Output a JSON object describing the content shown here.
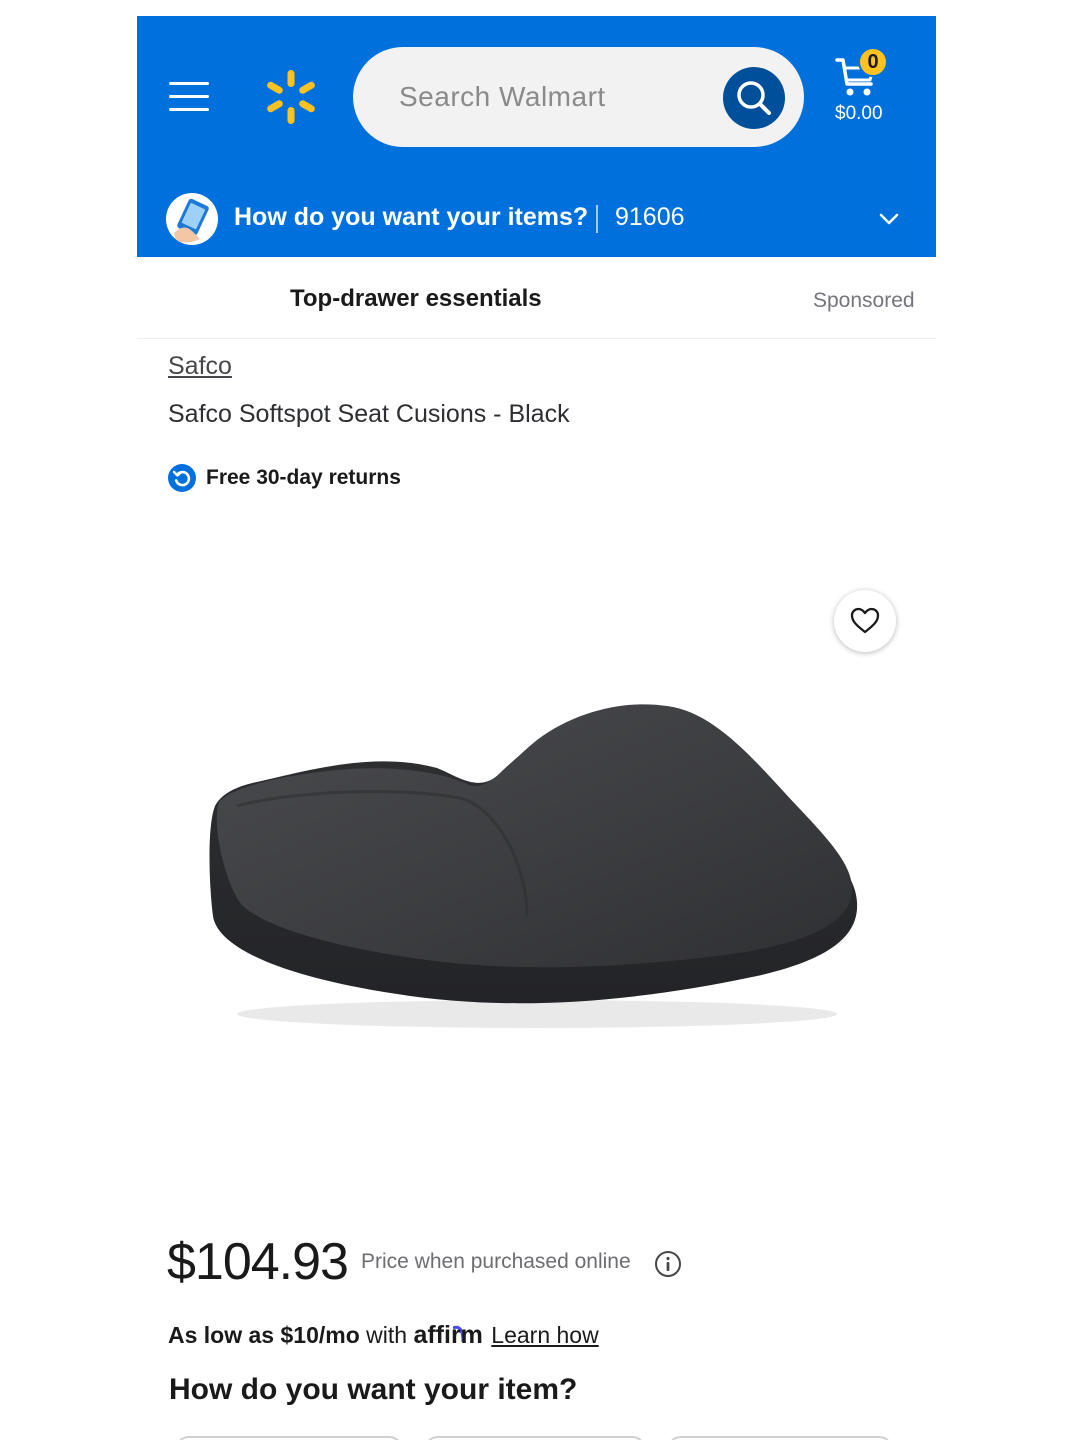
{
  "header": {
    "search_placeholder": "Search Walmart",
    "cart_count": "0",
    "cart_total": "$0.00",
    "brand_color": "#0071dc",
    "spark_color": "#ffc220",
    "icons": {
      "menu": "menu-icon",
      "logo": "walmart-spark-icon",
      "search": "search-icon",
      "cart": "cart-icon"
    }
  },
  "delivery": {
    "prompt": "How do you want your items?",
    "zip": "91606",
    "icon": "delivery-phone-icon",
    "chevron": "chevron-down-icon"
  },
  "promo": {
    "title": "Top-drawer essentials",
    "sponsored_label": "Sponsored"
  },
  "product": {
    "brand": "Safco",
    "title": "Safco Softspot Seat Cusions - Black",
    "returns": "Free 30-day returns",
    "favorite_icon": "heart-icon",
    "image_alt": "seat-cushion-product-image"
  },
  "pricing": {
    "price": "$104.93",
    "price_note": "Price when purchased online",
    "info_icon": "info-icon",
    "affirm_prefix": "As low as $10/mo",
    "affirm_with": "with",
    "affirm_brand": "affirm",
    "affirm_link": "Learn how"
  },
  "fulfillment": {
    "heading": "How do you want your item?"
  }
}
